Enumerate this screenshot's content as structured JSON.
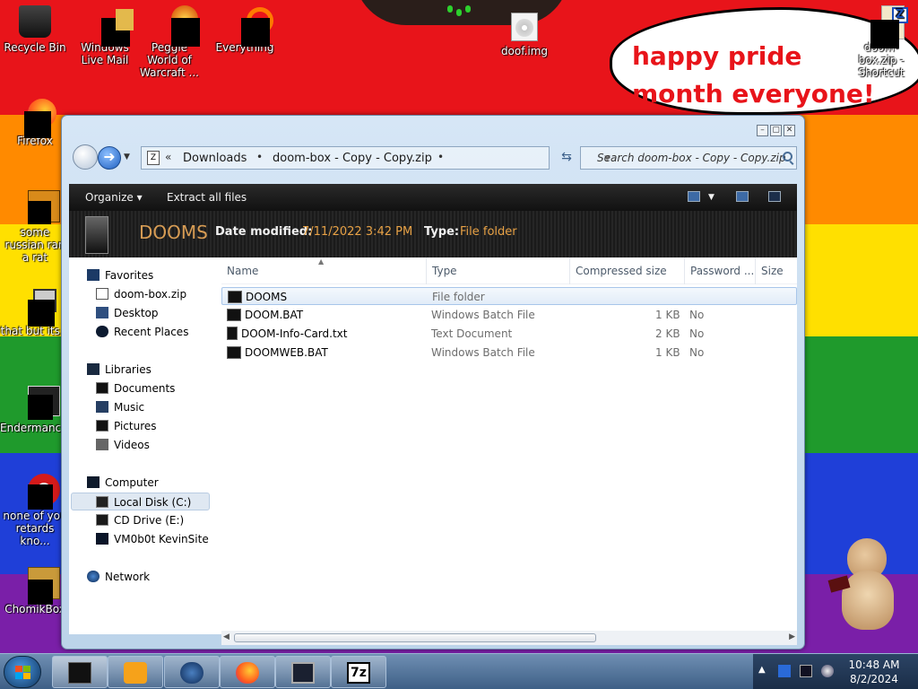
{
  "desktop": {
    "icons": [
      {
        "label": "Recycle Bin"
      },
      {
        "label": "Windows Live Mail"
      },
      {
        "label": "Peggle World of Warcraft ..."
      },
      {
        "label": "Everything"
      },
      {
        "label": "doof.img"
      },
      {
        "label": "doom-box.zip - Shortcut"
      },
      {
        "label": "Firefox"
      },
      {
        "label": "some russian ran a rat"
      },
      {
        "label": "that but its c"
      },
      {
        "label": "Endermanc..."
      },
      {
        "label": "none of you retards kno..."
      },
      {
        "label": "ChomikBox"
      }
    ],
    "speech_bubble": "happy pride month everyone!"
  },
  "window": {
    "address": {
      "crumbs": [
        "Downloads",
        "doom-box - Copy - Copy.zip"
      ],
      "overflow": "«"
    },
    "search_placeholder": "Search doom-box - Copy - Copy.zip",
    "toolbar": {
      "organize": "Organize",
      "extract": "Extract all files"
    },
    "details": {
      "name": "DOOMS",
      "date_label": "Date modified:",
      "date_value": "7/11/2022 3:42 PM",
      "type_label": "Type:",
      "type_value": "File folder"
    },
    "nav": {
      "favorites": "Favorites",
      "fav_items": [
        "doom-box.zip",
        "Desktop",
        "Recent Places"
      ],
      "libraries": "Libraries",
      "lib_items": [
        "Documents",
        "Music",
        "Pictures",
        "Videos"
      ],
      "computer": "Computer",
      "comp_items": [
        "Local Disk (C:)",
        "CD Drive (E:)",
        "VM0b0t KevinSite"
      ],
      "network": "Network"
    },
    "columns": [
      "Name",
      "Type",
      "Compressed size",
      "Password ...",
      "Size"
    ],
    "files": [
      {
        "name": "DOOMS",
        "type": "File folder",
        "compressed": "",
        "password": ""
      },
      {
        "name": "DOOM.BAT",
        "type": "Windows Batch File",
        "compressed": "1 KB",
        "password": "No"
      },
      {
        "name": "DOOM-Info-Card.txt",
        "type": "Text Document",
        "compressed": "2 KB",
        "password": "No"
      },
      {
        "name": "DOOMWEB.BAT",
        "type": "Windows Batch File",
        "compressed": "1 KB",
        "password": "No"
      }
    ]
  },
  "taskbar": {
    "pinned": [
      "media-player",
      "internet-explorer",
      "firefox",
      "explorer",
      "7zip"
    ],
    "sevenzip_label": "7z",
    "clock_time": "10:48 AM",
    "clock_date": "8/2/2024"
  },
  "colors": {
    "accent_orange": "#e8a246",
    "bubble_text": "#e8141a"
  }
}
